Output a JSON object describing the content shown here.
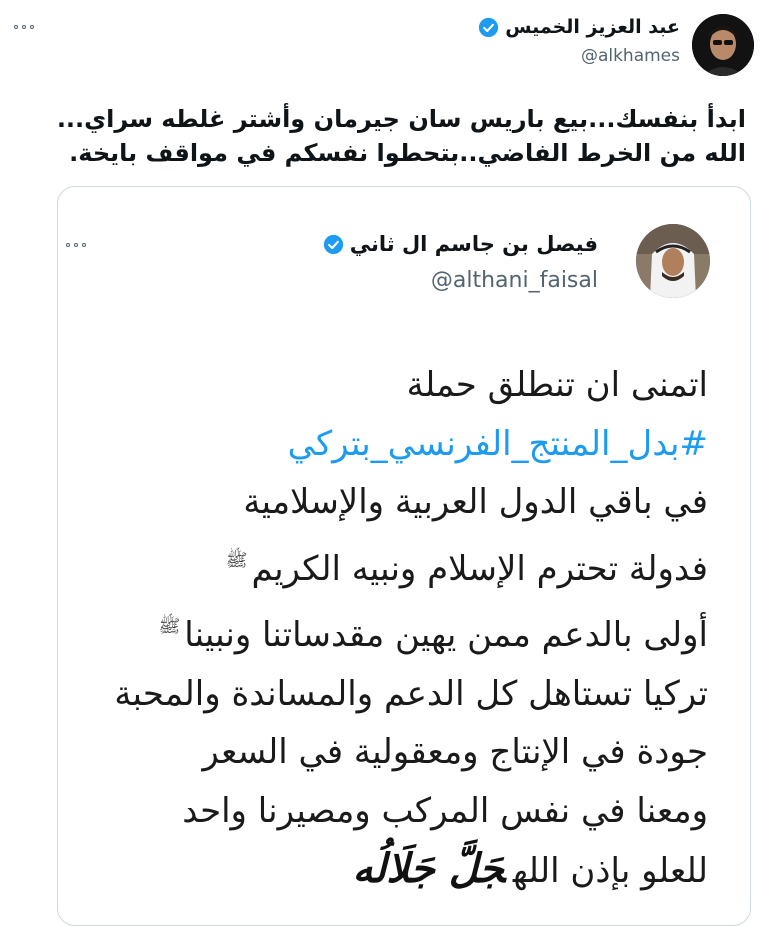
{
  "tweet": {
    "author_name": "عبد العزيز الخميس",
    "author_handle": "@alkhames",
    "text_lines": [
      "ابدأ بنفسك...بيع باريس سان جيرمان وأشتر غلطه سراي...",
      "الله من الخرط الفاضي..بتحطوا نفسكم في مواقف بايخة."
    ]
  },
  "quoted_tweet": {
    "author_name": "فيصل بن جاسم ال ثاني",
    "author_handle": "@althani_faisal",
    "lines": [
      "اتمنى ان تنطلق حملة",
      "#بدل_المنتج_الفرنسي_بتركي",
      "في باقي الدول العربية والإسلامية",
      "فدولة تحترم الإسلام ونبيه الكريم",
      "أولى بالدعم ممن يهين مقدساتنا ونبينا",
      "تركيا تستاهل كل الدعم والمساندة والمحبة",
      "جودة في الإنتاج ومعقولية في السعر",
      "ومعنا في نفس المركب ومصيرنا واحد",
      "للعلو بإذن الله"
    ],
    "honorific": "ﷺ",
    "calligraphy": "جَلَّ جَلَالُه"
  },
  "icons": {
    "verified": "verified-badge-icon",
    "more": "more-options-icon"
  },
  "colors": {
    "verified": "#1d9bf0",
    "hashtag": "#1d9bf0",
    "secondary_text": "#536471",
    "border": "#cfd9de"
  }
}
